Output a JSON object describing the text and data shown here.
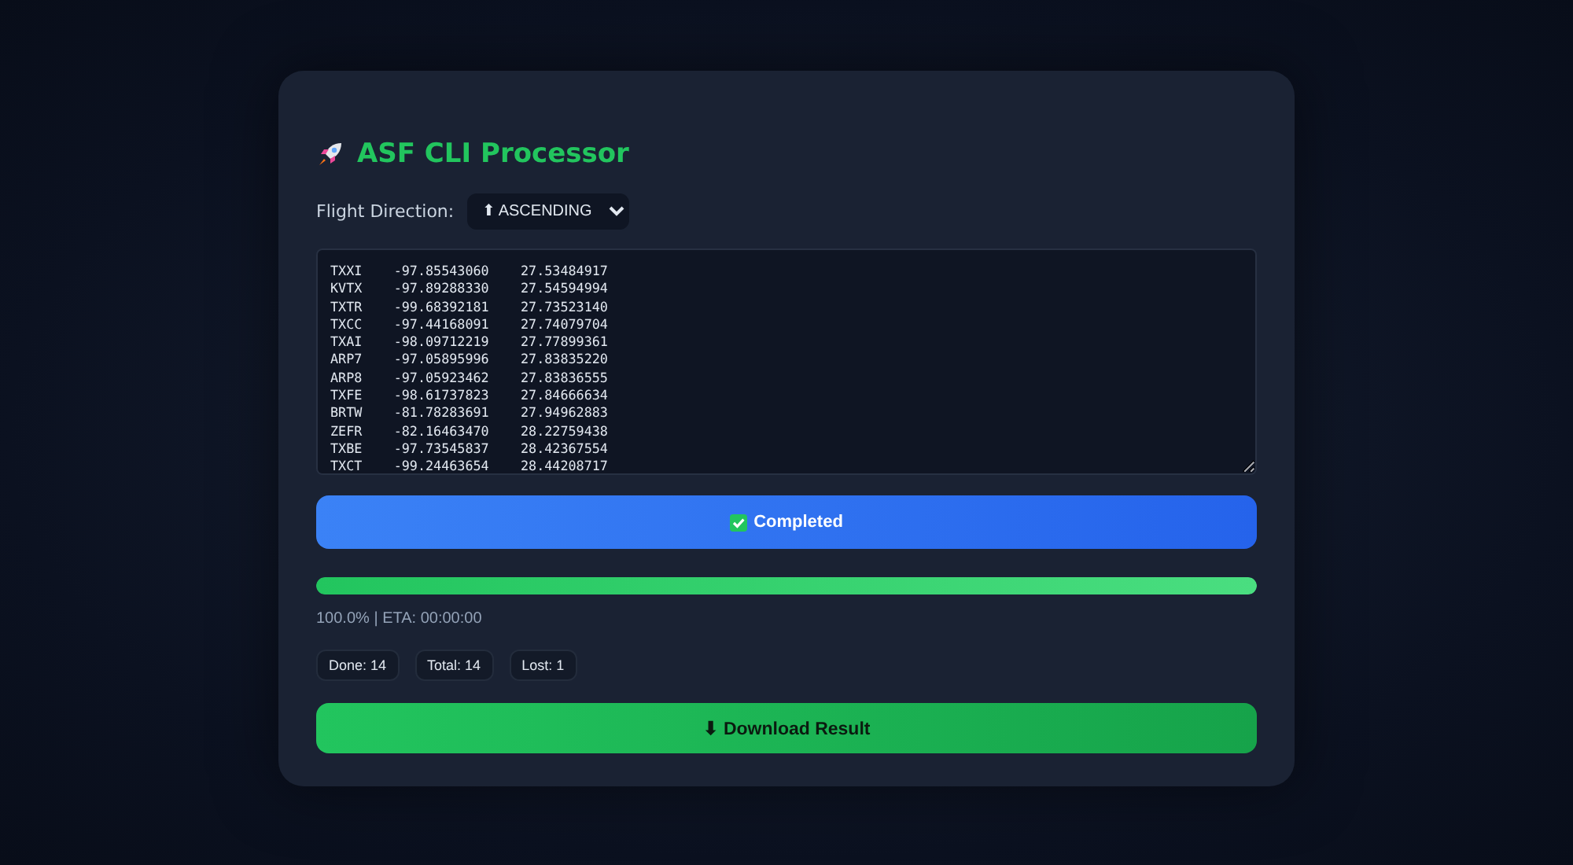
{
  "title": "ASF CLI Processor",
  "direction": {
    "label": "Flight Direction:",
    "value": "⬆ ASCENDING"
  },
  "coordinates": [
    "TXXI    -97.85543060    27.53484917",
    "KVTX    -97.89288330    27.54594994",
    "TXTR    -99.68392181    27.73523140",
    "TXCC    -97.44168091    27.74079704",
    "TXAI    -98.09712219    27.77899361",
    "ARP7    -97.05895996    27.83835220",
    "ARP8    -97.05923462    27.83836555",
    "TXFE    -98.61737823    27.84666634",
    "BRTW    -81.78283691    27.94962883",
    "ZEFR    -82.16463470    28.22759438",
    "TXBE    -97.73545837    28.42367554",
    "TXCT    -99.24463654    28.44208717"
  ],
  "status_button": {
    "label": "Completed",
    "done": true
  },
  "progress": {
    "level": 1.0,
    "text": "100.0% | ETA: 00:00:00"
  },
  "stats": [
    "Done: 14",
    "Total: 14",
    "Lost: 1"
  ],
  "download_button": {
    "label": "⬇ Download Result"
  }
}
